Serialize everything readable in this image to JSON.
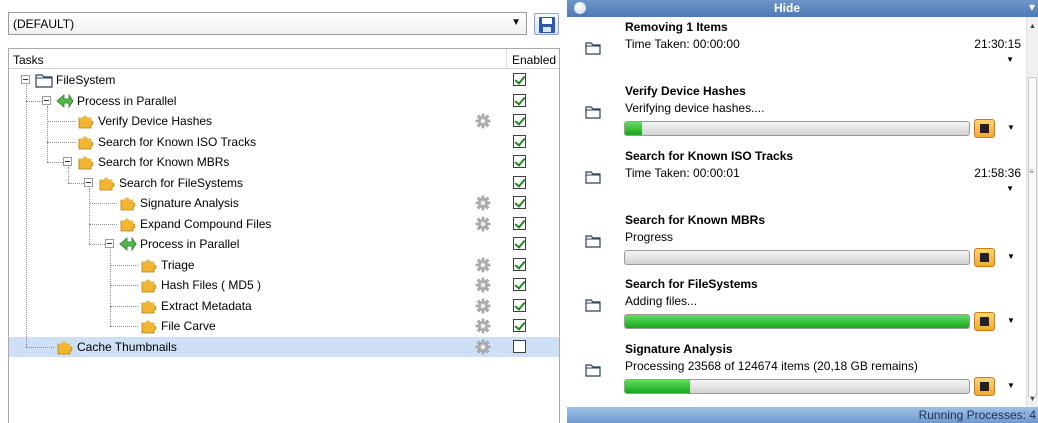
{
  "profile": {
    "selected": "(DEFAULT)"
  },
  "tree": {
    "col_tasks": "Tasks",
    "col_enabled": "Enabled",
    "rows": [
      {
        "label": "FileSystem",
        "icon": "folder-icon",
        "enabled": true,
        "gear": false,
        "expander": true,
        "selected": false
      },
      {
        "label": "Process in Parallel",
        "icon": "parallel-icon",
        "enabled": true,
        "gear": false,
        "expander": true,
        "selected": false
      },
      {
        "label": "Verify Device Hashes",
        "icon": "puzzle-icon",
        "enabled": true,
        "gear": true,
        "expander": false,
        "selected": false
      },
      {
        "label": "Search for Known ISO Tracks",
        "icon": "puzzle-icon",
        "enabled": true,
        "gear": false,
        "expander": false,
        "selected": false
      },
      {
        "label": "Search for Known MBRs",
        "icon": "puzzle-icon",
        "enabled": true,
        "gear": false,
        "expander": true,
        "selected": false
      },
      {
        "label": "Search for FileSystems",
        "icon": "puzzle-icon",
        "enabled": true,
        "gear": false,
        "expander": true,
        "selected": false
      },
      {
        "label": "Signature Analysis",
        "icon": "puzzle-icon",
        "enabled": true,
        "gear": true,
        "expander": false,
        "selected": false
      },
      {
        "label": "Expand Compound Files",
        "icon": "puzzle-icon",
        "enabled": true,
        "gear": true,
        "expander": false,
        "selected": false
      },
      {
        "label": "Process in Parallel",
        "icon": "parallel-icon",
        "enabled": true,
        "gear": false,
        "expander": true,
        "selected": false
      },
      {
        "label": "Triage",
        "icon": "puzzle-icon",
        "enabled": true,
        "gear": true,
        "expander": false,
        "selected": false
      },
      {
        "label": "Hash Files ( MD5 )",
        "icon": "puzzle-icon",
        "enabled": true,
        "gear": true,
        "expander": false,
        "selected": false
      },
      {
        "label": "Extract Metadata",
        "icon": "puzzle-icon",
        "enabled": true,
        "gear": true,
        "expander": false,
        "selected": false
      },
      {
        "label": "File Carve",
        "icon": "puzzle-icon",
        "enabled": true,
        "gear": true,
        "expander": false,
        "selected": false
      },
      {
        "label": "Cache Thumbnails",
        "icon": "puzzle-icon",
        "enabled": false,
        "gear": true,
        "expander": false,
        "selected": true
      }
    ]
  },
  "processes": {
    "header_label": "Hide",
    "status_text": "Running Processes: 4",
    "items": [
      {
        "title": "Removing 1 Items",
        "status": "Time Taken: 00:00:00",
        "time": "21:30:15",
        "progress": null
      },
      {
        "title": "Verify Device Hashes",
        "status": "Verifying device hashes....",
        "time": "",
        "progress": 0.05
      },
      {
        "title": "Search for Known ISO Tracks",
        "status": "Time Taken: 00:00:01",
        "time": "21:58:36",
        "progress": null
      },
      {
        "title": "Search for Known MBRs",
        "status": "Progress",
        "time": "",
        "progress": 0.0
      },
      {
        "title": "Search for FileSystems",
        "status": "Adding files...",
        "time": "",
        "progress": 1.0
      },
      {
        "title": "Signature Analysis",
        "status": "Processing 23568 of 124674 items (20,18 GB remains)",
        "time": "",
        "progress": 0.19
      }
    ]
  },
  "colors": {
    "accent": "#4d79b4",
    "selection": "#cde0f6",
    "progress_green": "#1aa51a",
    "stop_orange": "#f3a92a"
  }
}
